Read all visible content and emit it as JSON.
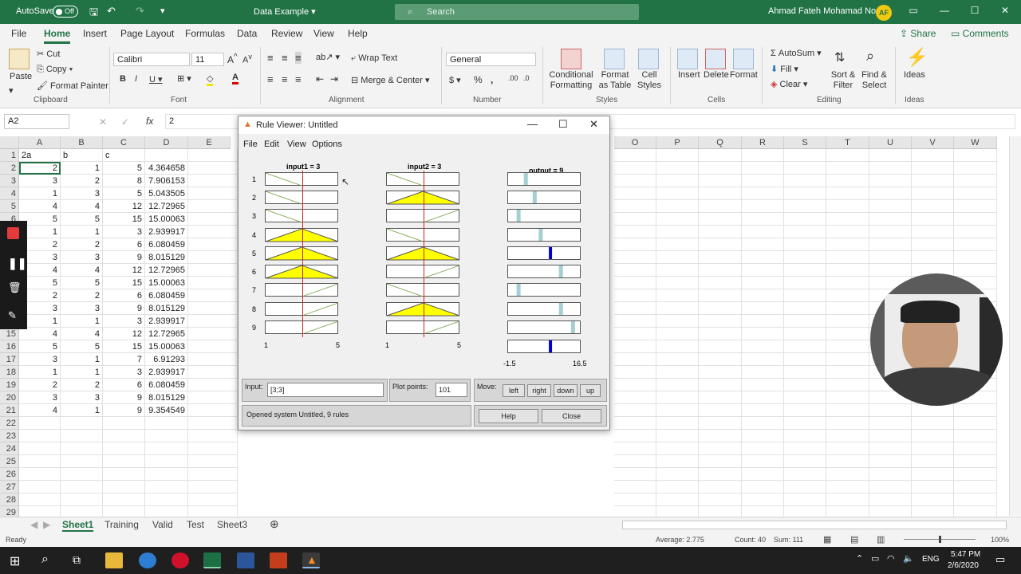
{
  "excel": {
    "autosave_label": "AutoSave",
    "autosave_state": "Off",
    "doc_title": "Data Example ▾",
    "search_placeholder": "Search",
    "user_name": "Ahmad Fateh Mohamad Nor",
    "user_initials": "AF",
    "menu_tabs": [
      "File",
      "Home",
      "Insert",
      "Page Layout",
      "Formulas",
      "Data",
      "Review",
      "View",
      "Help"
    ],
    "share_label": "Share",
    "comments_label": "Comments",
    "ribbon": {
      "clipboard": {
        "paste": "Paste",
        "cut": "Cut",
        "copy": "Copy",
        "format_painter": "Format Painter",
        "group": "Clipboard"
      },
      "font": {
        "name": "Calibri",
        "size": "11",
        "group": "Font"
      },
      "alignment": {
        "wrap": "Wrap Text",
        "merge": "Merge & Center",
        "group": "Alignment"
      },
      "number": {
        "format": "General",
        "group": "Number"
      },
      "styles": {
        "cond": "Conditional Formatting",
        "fmt_table": "Format as Table",
        "cell_styles": "Cell Styles",
        "group": "Styles"
      },
      "cells": {
        "insert": "Insert",
        "delete": "Delete",
        "format": "Format",
        "group": "Cells"
      },
      "editing": {
        "autosum": "AutoSum",
        "fill": "Fill",
        "clear": "Clear",
        "sort": "Sort & Filter",
        "find": "Find & Select",
        "group": "Editing"
      },
      "ideas": {
        "label": "Ideas",
        "group": "Ideas"
      }
    },
    "name_box": "A2",
    "formula": "2",
    "columns": [
      "A",
      "B",
      "C",
      "D",
      "E",
      "O",
      "P",
      "Q",
      "R",
      "S",
      "T",
      "U",
      "V",
      "W"
    ],
    "rows": [
      {
        "n": "1",
        "a": "2a",
        "b": "b",
        "c": "c",
        "d": ""
      },
      {
        "n": "2",
        "a": "2",
        "b": "1",
        "c": "5",
        "d": "4.364658"
      },
      {
        "n": "3",
        "a": "3",
        "b": "2",
        "c": "8",
        "d": "7.906153"
      },
      {
        "n": "4",
        "a": "1",
        "b": "3",
        "c": "5",
        "d": "5.043505"
      },
      {
        "n": "5",
        "a": "4",
        "b": "4",
        "c": "12",
        "d": "12.72965"
      },
      {
        "n": "6",
        "a": "5",
        "b": "5",
        "c": "15",
        "d": "15.00063"
      },
      {
        "n": "7",
        "a": "1",
        "b": "1",
        "c": "3",
        "d": "2.939917"
      },
      {
        "n": "8",
        "a": "2",
        "b": "2",
        "c": "6",
        "d": "6.080459"
      },
      {
        "n": "9",
        "a": "3",
        "b": "3",
        "c": "9",
        "d": "8.015129"
      },
      {
        "n": "10",
        "a": "4",
        "b": "4",
        "c": "12",
        "d": "12.72965"
      },
      {
        "n": "11",
        "a": "5",
        "b": "5",
        "c": "15",
        "d": "15.00063"
      },
      {
        "n": "12",
        "a": "2",
        "b": "2",
        "c": "6",
        "d": "6.080459"
      },
      {
        "n": "13",
        "a": "3",
        "b": "3",
        "c": "9",
        "d": "8.015129"
      },
      {
        "n": "14",
        "a": "1",
        "b": "1",
        "c": "3",
        "d": "2.939917"
      },
      {
        "n": "15",
        "a": "4",
        "b": "4",
        "c": "12",
        "d": "12.72965"
      },
      {
        "n": "16",
        "a": "5",
        "b": "5",
        "c": "15",
        "d": "15.00063"
      },
      {
        "n": "17",
        "a": "3",
        "b": "1",
        "c": "7",
        "d": "6.91293"
      },
      {
        "n": "18",
        "a": "1",
        "b": "1",
        "c": "3",
        "d": "2.939917"
      },
      {
        "n": "19",
        "a": "2",
        "b": "2",
        "c": "6",
        "d": "6.080459"
      },
      {
        "n": "20",
        "a": "3",
        "b": "3",
        "c": "9",
        "d": "8.015129"
      },
      {
        "n": "21",
        "a": "4",
        "b": "1",
        "c": "9",
        "d": "9.354549"
      },
      {
        "n": "22",
        "a": "",
        "b": "",
        "c": "",
        "d": ""
      },
      {
        "n": "23",
        "a": "",
        "b": "",
        "c": "",
        "d": ""
      },
      {
        "n": "24",
        "a": "",
        "b": "",
        "c": "",
        "d": ""
      },
      {
        "n": "25",
        "a": "",
        "b": "",
        "c": "",
        "d": ""
      },
      {
        "n": "26",
        "a": "",
        "b": "",
        "c": "",
        "d": ""
      },
      {
        "n": "27",
        "a": "",
        "b": "",
        "c": "",
        "d": ""
      },
      {
        "n": "28",
        "a": "",
        "b": "",
        "c": "",
        "d": ""
      },
      {
        "n": "29",
        "a": "",
        "b": "",
        "c": "",
        "d": ""
      }
    ],
    "sheet_tabs": [
      "Sheet1",
      "Training",
      "Valid",
      "Test",
      "Sheet3"
    ],
    "status": {
      "ready": "Ready",
      "average": "Average: 2.775",
      "count": "Count: 40",
      "sum": "Sum: 111",
      "zoom": "100%"
    },
    "clock": {
      "time": "5:47 PM",
      "date": "2/6/2020",
      "lang": "ENG"
    }
  },
  "rule_viewer": {
    "title": "Rule Viewer: Untitled",
    "menu": [
      "File",
      "Edit",
      "View",
      "Options"
    ],
    "input1_label": "input1 = 3",
    "input2_label": "input2 = 3",
    "output_label": "output = 9",
    "rule_numbers": [
      "1",
      "2",
      "3",
      "4",
      "5",
      "6",
      "7",
      "8",
      "9"
    ],
    "in_range_min": "1",
    "in_range_max": "5",
    "out_range_min": "-1.5",
    "out_range_max": "16.5",
    "input1_mf": [
      "low",
      "low",
      "low",
      "mid",
      "mid",
      "mid",
      "high",
      "high",
      "high"
    ],
    "input1_fire": [
      false,
      false,
      false,
      true,
      true,
      true,
      false,
      false,
      false
    ],
    "input2_mf": [
      "low",
      "mid",
      "high",
      "low",
      "mid",
      "high",
      "low",
      "mid",
      "high"
    ],
    "input2_fire": [
      false,
      true,
      false,
      false,
      true,
      false,
      false,
      true,
      false
    ],
    "output_values": [
      2.8,
      5,
      1,
      6.5,
      9,
      11.5,
      1,
      11.5,
      14.5
    ],
    "output_fire": [
      false,
      false,
      false,
      false,
      true,
      false,
      false,
      false,
      false
    ],
    "aggregate_value": 9,
    "input_label": "Input:",
    "input_value": "[3;3]",
    "plot_points_label": "Plot points:",
    "plot_points_value": "101",
    "move_label": "Move:",
    "move_buttons": [
      "left",
      "right",
      "down",
      "up"
    ],
    "status_text": "Opened system Untitled, 9 rules",
    "help_label": "Help",
    "close_label": "Close",
    "colors": {
      "fired": "#ffff00",
      "line": "#6f9c3a",
      "cursor": "#cc2222",
      "out_bar": "#a6cfd3",
      "out_fire": "#0000cc"
    }
  }
}
